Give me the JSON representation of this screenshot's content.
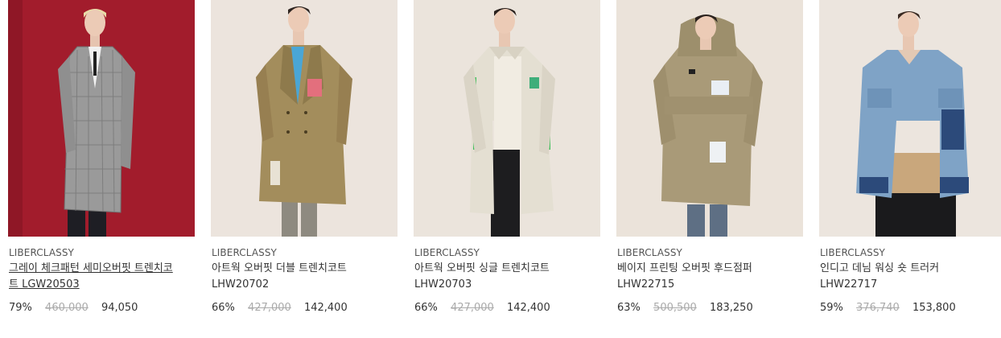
{
  "products": [
    {
      "brand": "LIBERCLASSY",
      "name": "그레이 체크패턴 세미오버핏 트렌치코트 LGW20503",
      "discount": "79%",
      "original_price": "460,000",
      "sale_price": "94,050",
      "image_icon": "model-gray-check-coat-image",
      "bg_color": "#a21c2c",
      "coat_color": "#9a9a9a"
    },
    {
      "brand": "LIBERCLASSY",
      "name": "아트웍 오버핏 더블 트렌치코트 LHW20702",
      "discount": "66%",
      "original_price": "427,000",
      "sale_price": "142,400",
      "image_icon": "model-double-trench-image",
      "bg_color": "#ece4dd",
      "coat_color": "#a38d5c"
    },
    {
      "brand": "LIBERCLASSY",
      "name": "아트웍 오버핏 싱글 트렌치코트 LHW20703",
      "discount": "66%",
      "original_price": "427,000",
      "sale_price": "142,400",
      "image_icon": "model-single-trench-image",
      "bg_color": "#ebe4dc",
      "coat_color": "#e4dfd2"
    },
    {
      "brand": "LIBERCLASSY",
      "name": "베이지 프린팅 오버핏 후드점퍼 LHW22715",
      "discount": "63%",
      "original_price": "500,500",
      "sale_price": "183,250",
      "image_icon": "model-beige-hooded-jumper-image",
      "bg_color": "#ebe3da",
      "coat_color": "#a99a78"
    },
    {
      "brand": "LIBERCLASSY",
      "name": "인디고 데님 워싱 숏 트러커 LHW22717",
      "discount": "59%",
      "original_price": "376,740",
      "sale_price": "153,800",
      "image_icon": "model-denim-trucker-image",
      "bg_color": "#ece5de",
      "coat_color": "#7fa3c6"
    }
  ]
}
